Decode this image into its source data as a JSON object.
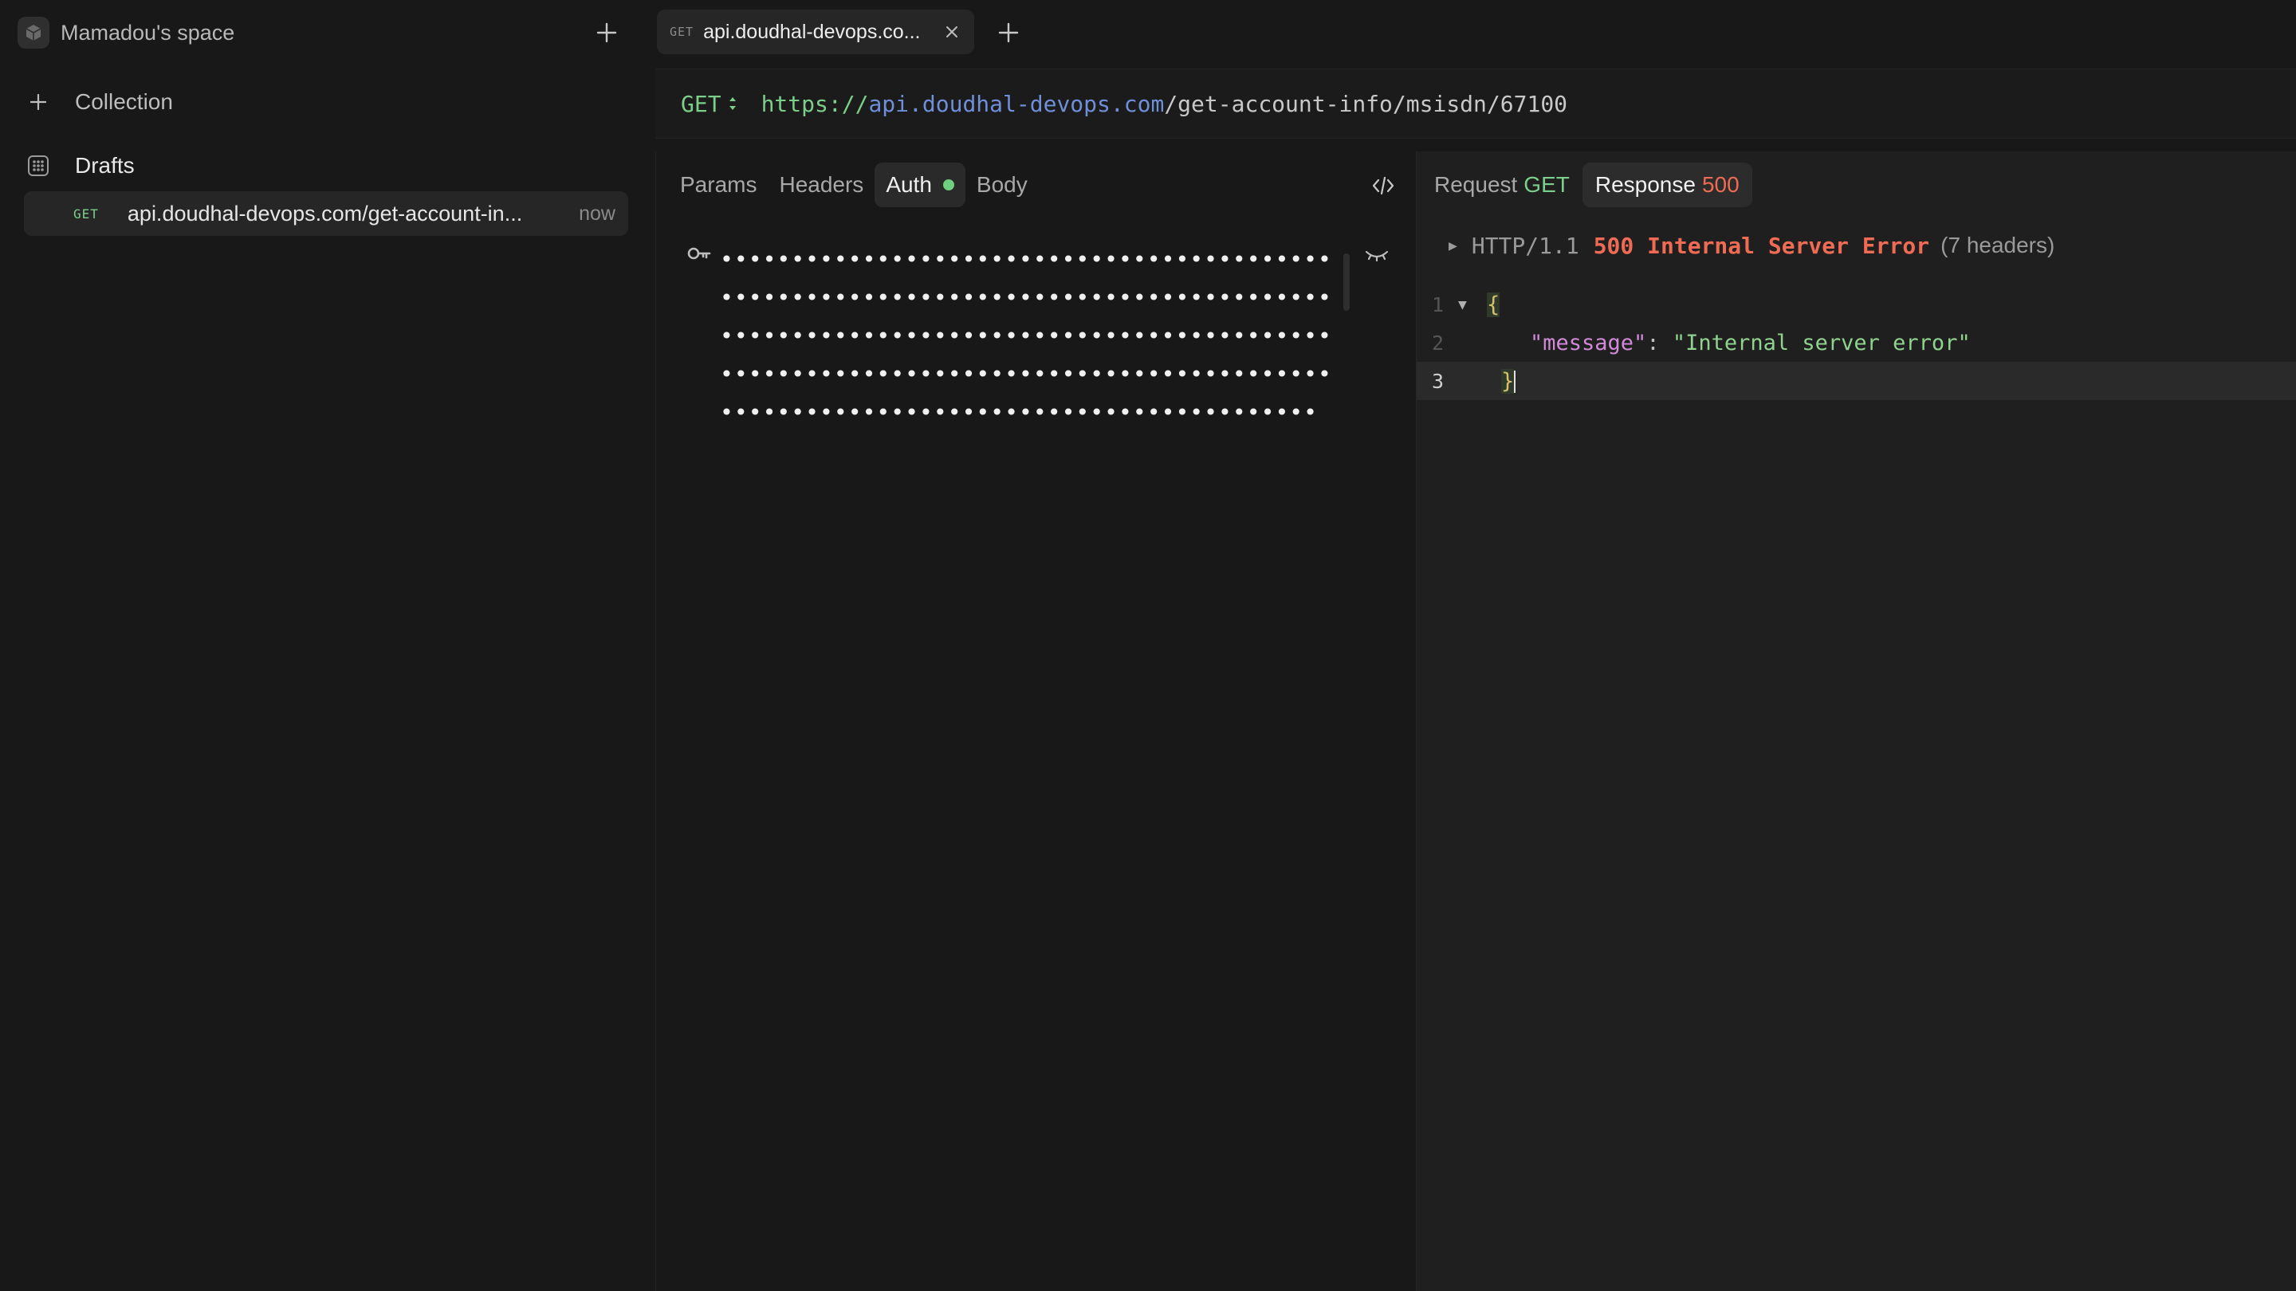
{
  "workspace": {
    "name": "Mamadou's space"
  },
  "sidebar": {
    "collection_label": "Collection",
    "drafts_label": "Drafts",
    "draft_item": {
      "method": "GET",
      "name": "api.doudhal-devops.com/get-account-in...",
      "time": "now"
    }
  },
  "tab": {
    "method": "GET",
    "name": "api.doudhal-devops.co..."
  },
  "request": {
    "method": "GET",
    "url": {
      "scheme": "https://",
      "host": "api.doudhal-devops.com",
      "path": "/get-account-info/msisdn/67100"
    },
    "tabs": [
      "Params",
      "Headers",
      "Auth",
      "Body"
    ],
    "active_tab": "Auth",
    "auth_masked": "••••••••••••••••••••••••••••••••••••••••••••••••••••••••••••••••••••••••••••••••••••••••••••••••••••••••••••••••••••••••••••••••••••••••••••••••••••••••••••••••••••••••••••••••••••••••••••••••••••••••••••••••••••••"
  },
  "response": {
    "tab_request_label": "Request",
    "tab_request_value": "GET",
    "tab_response_label": "Response",
    "tab_response_value": "500",
    "protocol": "HTTP/1.1",
    "status": "500 Internal Server Error",
    "headers_count": "(7 headers)",
    "body": {
      "line_numbers": [
        "1",
        "2",
        "3"
      ],
      "open_brace": "{",
      "key": "\"message\"",
      "colon": ": ",
      "value": "\"Internal server error\"",
      "close_brace": "}"
    }
  },
  "colors": {
    "accent_green": "#7ccf8a",
    "error_red": "#ef6b53",
    "url_host": "#6f8fd8",
    "background": "#181818"
  },
  "icons": [
    "cube-icon",
    "plus-icon",
    "grid-icon",
    "close-icon",
    "sort-arrows-icon",
    "code-icon",
    "key-icon",
    "eye-closed-icon",
    "triangle-right-icon",
    "triangle-down-icon"
  ]
}
